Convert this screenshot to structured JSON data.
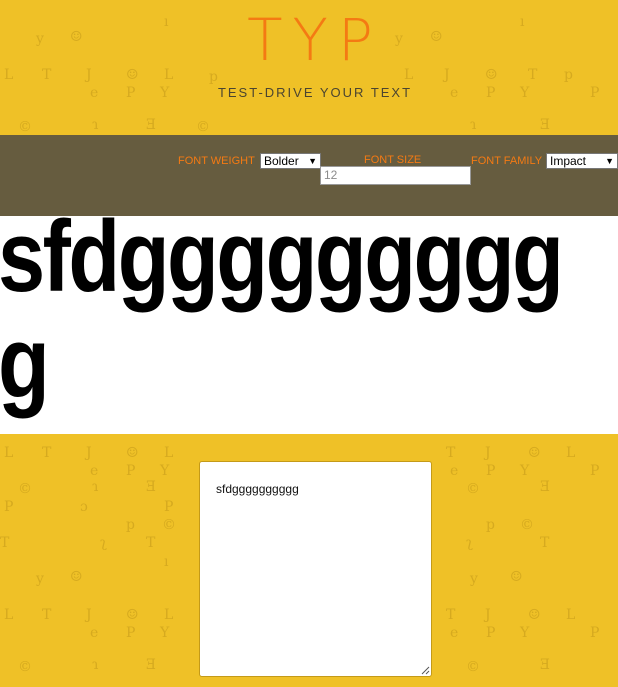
{
  "header": {
    "logo": "TYP",
    "tagline": "TEST-DRIVE YOUR TEXT"
  },
  "controls": {
    "font_weight": {
      "label": "FONT WEIGHT",
      "selected": "Bolder"
    },
    "font_size": {
      "label": "FONT SIZE",
      "placeholder": "12"
    },
    "font_family": {
      "label": "FONT FAMILY",
      "selected": "Impact"
    }
  },
  "preview": {
    "text": "sfdgggggggggg"
  },
  "editor": {
    "value": "sfdgggggggggg"
  },
  "colors": {
    "background": "#efc127",
    "accent": "#f47a13",
    "toolbar": "#665c3f",
    "pattern": "#d6aa1f"
  },
  "icons": [
    "caret-down-icon",
    "resize-grip-icon"
  ]
}
